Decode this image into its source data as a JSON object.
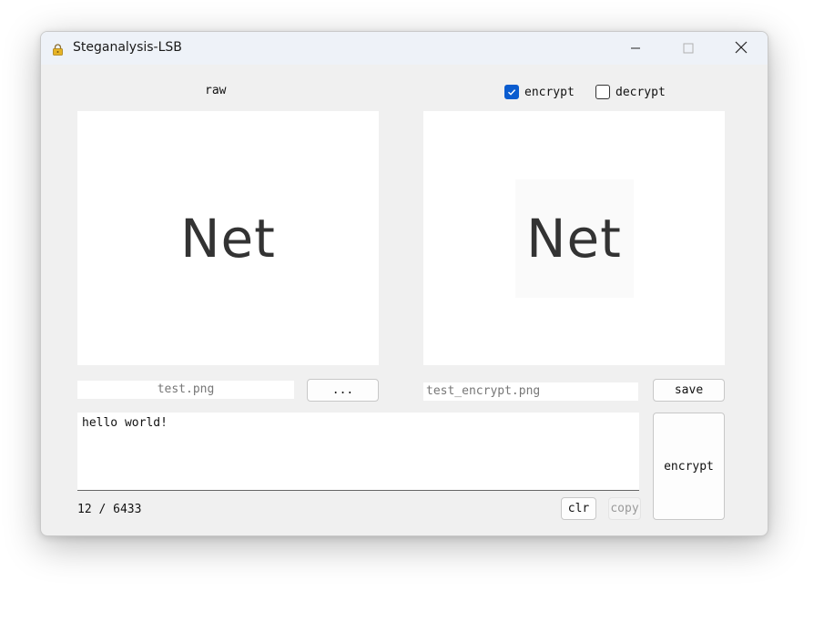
{
  "window": {
    "title": "Steganalysis-LSB",
    "app_icon": "lock-icon",
    "controls": [
      "minimize-icon",
      "maximize-icon",
      "close-icon"
    ]
  },
  "left": {
    "label": "raw",
    "image_text": "Net",
    "file_name": "test.png",
    "browse_label": "..."
  },
  "right": {
    "encrypt_option": {
      "label": "encrypt",
      "checked": true
    },
    "decrypt_option": {
      "label": "decrypt",
      "checked": false
    },
    "image_text": "Net",
    "file_name": "test_encrypt.png",
    "save_label": "save"
  },
  "message": {
    "text": "hello world!",
    "counter": "12 / 6433",
    "clear_label": "clr",
    "copy_label": "copy"
  },
  "action": {
    "encrypt_label": "encrypt"
  },
  "colors": {
    "accent": "#0a5ccf",
    "window_bg": "#f0f0f0",
    "titlebar_bg": "#eef2f8"
  }
}
